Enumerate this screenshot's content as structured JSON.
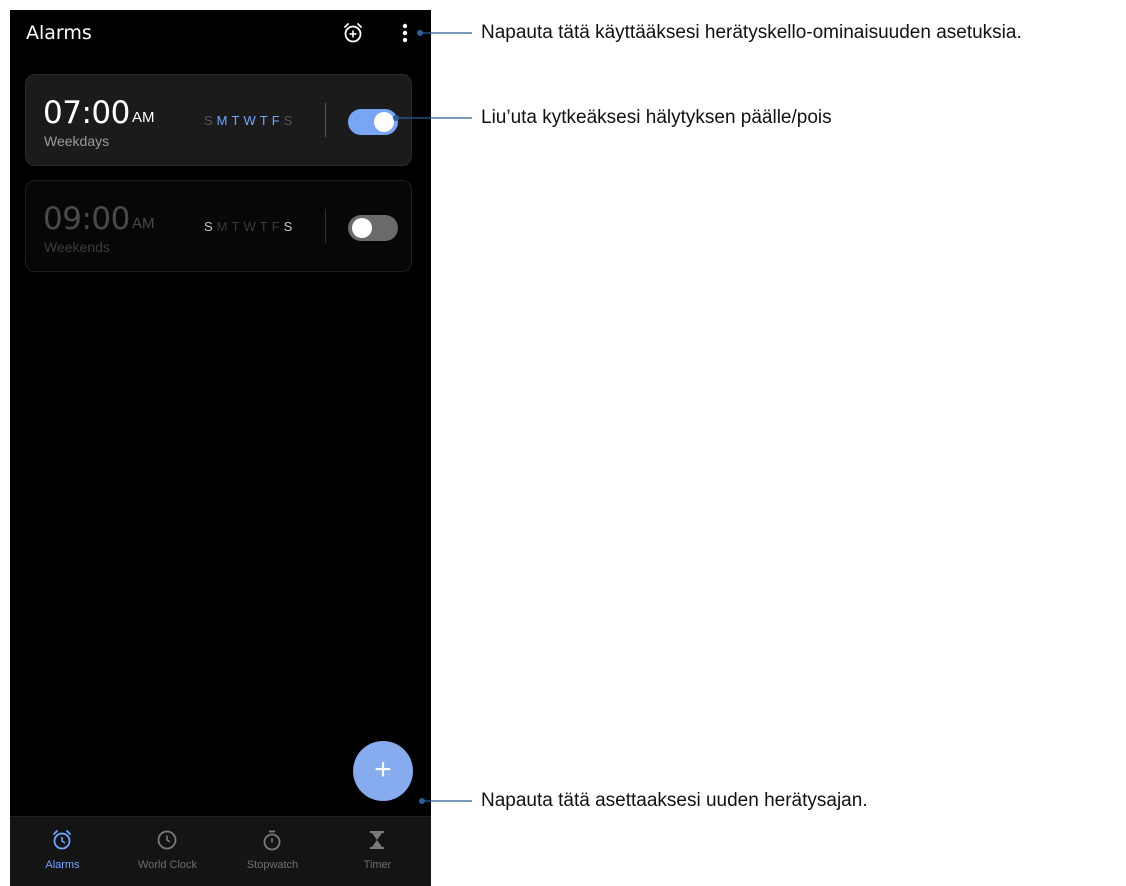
{
  "app": {
    "title": "Alarms"
  },
  "alarms": [
    {
      "time": "07:00",
      "ampm": "AM",
      "label": "Weekdays",
      "days": [
        "S",
        "M",
        "T",
        "W",
        "T",
        "F",
        "S"
      ],
      "active_days": [
        false,
        true,
        true,
        true,
        true,
        true,
        false
      ],
      "enabled": true
    },
    {
      "time": "09:00",
      "ampm": "AM",
      "label": "Weekends",
      "days": [
        "S",
        "M",
        "T",
        "W",
        "T",
        "F",
        "S"
      ],
      "active_days": [
        true,
        false,
        false,
        false,
        false,
        false,
        true
      ],
      "enabled": false
    }
  ],
  "fab": {
    "symbol": "+"
  },
  "nav": [
    {
      "label": "Alarms",
      "icon": "alarm-clock-icon",
      "active": true
    },
    {
      "label": "World Clock",
      "icon": "clock-icon",
      "active": false
    },
    {
      "label": "Stopwatch",
      "icon": "stopwatch-icon",
      "active": false
    },
    {
      "label": "Timer",
      "icon": "hourglass-icon",
      "active": false
    }
  ],
  "callouts": {
    "settings": "Napauta tätä käyttääksesi herätyskello-ominaisuuden asetuksia.",
    "toggle": "Liu’uta kytkeäksesi hälytyksen päälle/pois",
    "add": "Napauta tätä asettaaksesi uuden herätysajan."
  },
  "colors": {
    "accent": "#6fa6ff",
    "toggle_on": "#78a6f5",
    "fab": "#86abef",
    "background": "#000000",
    "callout_line": "#2a5d9a"
  }
}
